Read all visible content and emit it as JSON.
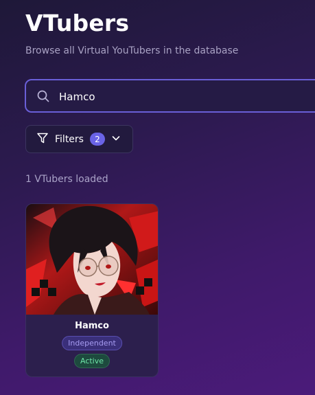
{
  "header": {
    "title": "VTubers",
    "subtitle": "Browse all Virtual YouTubers in the database"
  },
  "search": {
    "value": "Hamco",
    "icon": "search-icon"
  },
  "filters": {
    "label": "Filters",
    "count": "2",
    "icon": "filter-icon"
  },
  "results": {
    "count_text": "1 VTubers loaded"
  },
  "cards": [
    {
      "name": "Hamco",
      "affiliation": "Independent",
      "status": "Active"
    }
  ],
  "colors": {
    "accent": "#6a63e6",
    "status_active": "#6ee7a8",
    "affiliation": "#a79cf2"
  }
}
